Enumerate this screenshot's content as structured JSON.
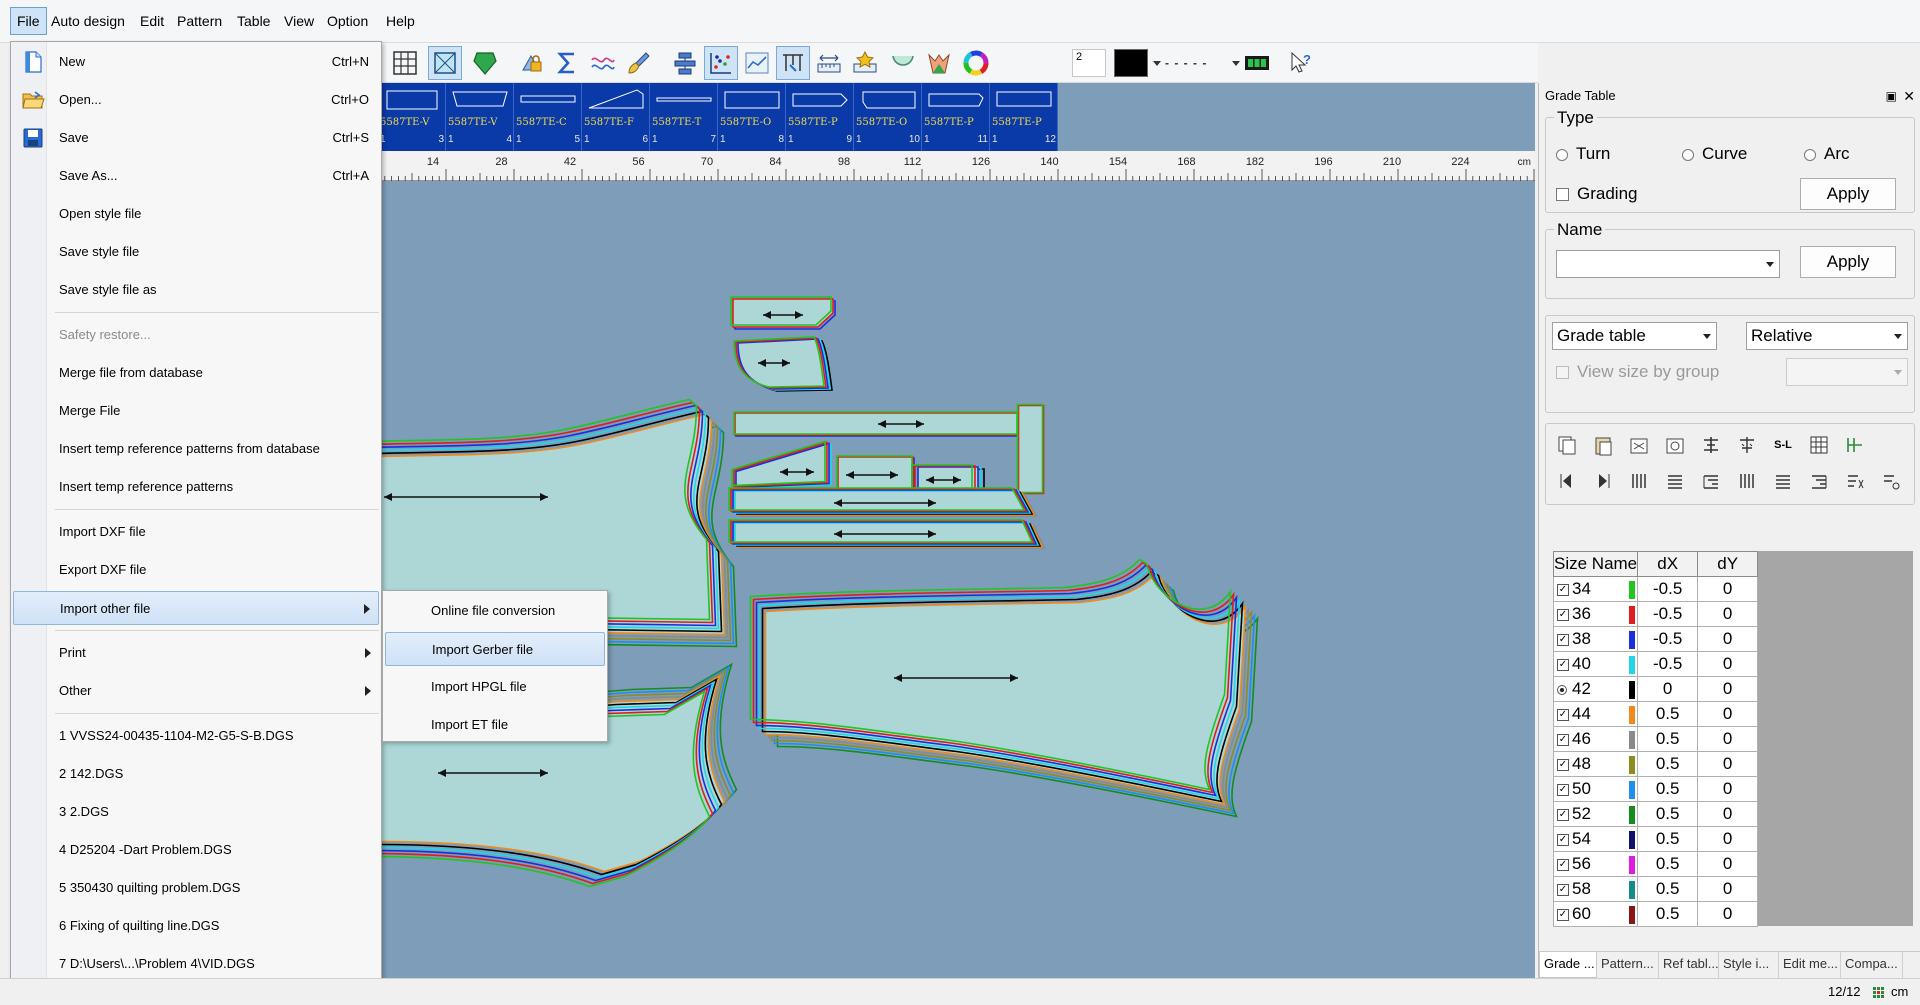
{
  "menubar": {
    "items": [
      {
        "label": "File",
        "active": true
      },
      {
        "label": "Auto design"
      },
      {
        "label": "Edit"
      },
      {
        "label": "Pattern"
      },
      {
        "label": "Table"
      },
      {
        "label": "View"
      },
      {
        "label": "Option"
      },
      {
        "label": "Help"
      }
    ]
  },
  "toolbar": {
    "icons": [
      "grid-icon",
      "frame-icon",
      "shield-icon",
      "lock-icon",
      "sigma-icon",
      "wave-icon",
      "brush-icon",
      "stack-icon",
      "plot-icon",
      "chart-icon",
      "measure-icon",
      "ruler-icon",
      "star-icon",
      "cup-icon",
      "bag-icon",
      "color-wheel-icon"
    ],
    "line_width_value": "2",
    "color_value": "#000000",
    "line_style": "- - - - -"
  },
  "thumbnails": [
    {
      "name": "5587TE-V",
      "qty": "1",
      "num": "3"
    },
    {
      "name": "5587TE-V",
      "qty": "1",
      "num": "4"
    },
    {
      "name": "5587TE-C",
      "qty": "1",
      "num": "5"
    },
    {
      "name": "5587TE-F",
      "qty": "1",
      "num": "6"
    },
    {
      "name": "5587TE-T",
      "qty": "1",
      "num": "7"
    },
    {
      "name": "5587TE-O",
      "qty": "1",
      "num": "8"
    },
    {
      "name": "5587TE-P",
      "qty": "1",
      "num": "9"
    },
    {
      "name": "5587TE-O",
      "qty": "1",
      "num": "10"
    },
    {
      "name": "5587TE-P",
      "qty": "1",
      "num": "11"
    },
    {
      "name": "5587TE-P",
      "qty": "1",
      "num": "12"
    }
  ],
  "ruler": {
    "labels": [
      "14",
      "28",
      "42",
      "56",
      "70",
      "84",
      "98",
      "112",
      "126",
      "140",
      "154",
      "168",
      "182",
      "196",
      "210",
      "224"
    ],
    "unit": "cm"
  },
  "file_menu": {
    "items": [
      {
        "label": "New",
        "shortcut": "Ctrl+N",
        "icon": "new-file-icon"
      },
      {
        "label": "Open...",
        "shortcut": "Ctrl+O",
        "icon": "open-folder-icon"
      },
      {
        "label": "Save",
        "shortcut": "Ctrl+S",
        "icon": "save-icon"
      },
      {
        "label": "Save As...",
        "shortcut": "Ctrl+A"
      },
      {
        "label": "Open style file"
      },
      {
        "label": "Save style file"
      },
      {
        "label": "Save style file as"
      },
      {
        "label": "Safety restore...",
        "disabled": true
      },
      {
        "label": "Merge file from database"
      },
      {
        "label": "Merge File"
      },
      {
        "label": "Insert temp reference patterns from database"
      },
      {
        "label": "Insert temp reference patterns"
      },
      {
        "label": "Import DXF file"
      },
      {
        "label": "Export DXF file"
      },
      {
        "label": "Import other file",
        "submenu": true,
        "hover": true
      },
      {
        "label": "Print",
        "submenu": true
      },
      {
        "label": "Other",
        "submenu": true
      },
      {
        "label": "1 VVSS24-00435-1104-M2-G5-S-B.DGS"
      },
      {
        "label": "2 142.DGS"
      },
      {
        "label": "3 2.DGS"
      },
      {
        "label": "4 D25204 -Dart Problem.DGS"
      },
      {
        "label": "5 350430 quilting problem.DGS"
      },
      {
        "label": "6 Fixing of quilting line.DGS"
      },
      {
        "label": "7 D:\\Users\\...\\Problem 4\\VID.DGS"
      }
    ]
  },
  "import_submenu": {
    "items": [
      {
        "label": "Online file conversion"
      },
      {
        "label": "Import Gerber file",
        "hover": true
      },
      {
        "label": "Import HPGL file"
      },
      {
        "label": "Import ET file"
      }
    ]
  },
  "grade_panel": {
    "title": "Grade Table",
    "type_group": {
      "title": "Type",
      "options": [
        "Turn",
        "Curve",
        "Arc"
      ],
      "grading_label": "Grading",
      "apply_label": "Apply"
    },
    "name_group": {
      "title": "Name",
      "value": "",
      "apply_label": "Apply"
    },
    "table_select": "Grade table",
    "mode_select": "Relative",
    "view_by_group_label": "View size by group",
    "icon_row1": [
      "copy-icon",
      "paste-icon",
      "clear-icon",
      "refresh-icon",
      "align-icon",
      "scatter-icon",
      "sl-icon",
      "table-icon",
      "split-icon"
    ],
    "icon_row2": [
      "prev-icon",
      "next-icon",
      "columns-icon",
      "rows-icon",
      "step-icon",
      "columns2-icon",
      "rows2-icon",
      "step2-icon",
      "formula-icon",
      "extra-icon"
    ],
    "sl_label": "S-L",
    "table": {
      "headers": [
        "Size Name",
        "dX",
        "dY"
      ],
      "rows": [
        {
          "size": "34",
          "dx": "-0.5",
          "dy": "0",
          "color": "#22c422",
          "base": false
        },
        {
          "size": "36",
          "dx": "-0.5",
          "dy": "0",
          "color": "#e01c1c",
          "base": false
        },
        {
          "size": "38",
          "dx": "-0.5",
          "dy": "0",
          "color": "#1a2ee0",
          "base": false
        },
        {
          "size": "40",
          "dx": "-0.5",
          "dy": "0",
          "color": "#20d6e8",
          "base": false
        },
        {
          "size": "42",
          "dx": "0",
          "dy": "0",
          "color": "#000000",
          "base": true
        },
        {
          "size": "44",
          "dx": "0.5",
          "dy": "0",
          "color": "#f08a1e",
          "base": false
        },
        {
          "size": "46",
          "dx": "0.5",
          "dy": "0",
          "color": "#8a8a8a",
          "base": false
        },
        {
          "size": "48",
          "dx": "0.5",
          "dy": "0",
          "color": "#8c8c22",
          "base": false
        },
        {
          "size": "50",
          "dx": "0.5",
          "dy": "0",
          "color": "#1e8ef0",
          "base": false
        },
        {
          "size": "52",
          "dx": "0.5",
          "dy": "0",
          "color": "#148c1e",
          "base": false
        },
        {
          "size": "54",
          "dx": "0.5",
          "dy": "0",
          "color": "#10106e",
          "base": false
        },
        {
          "size": "56",
          "dx": "0.5",
          "dy": "0",
          "color": "#e01ce0",
          "base": false
        },
        {
          "size": "58",
          "dx": "0.5",
          "dy": "0",
          "color": "#148c8c",
          "base": false
        },
        {
          "size": "60",
          "dx": "0.5",
          "dy": "0",
          "color": "#8c1414",
          "base": false
        }
      ]
    },
    "bottom_tabs": [
      "Grade ...",
      "Pattern...",
      "Ref tabl...",
      "Style i...",
      "Edit me...",
      "Compa..."
    ]
  },
  "statusbar": {
    "page": "12/12",
    "unit": "cm"
  }
}
